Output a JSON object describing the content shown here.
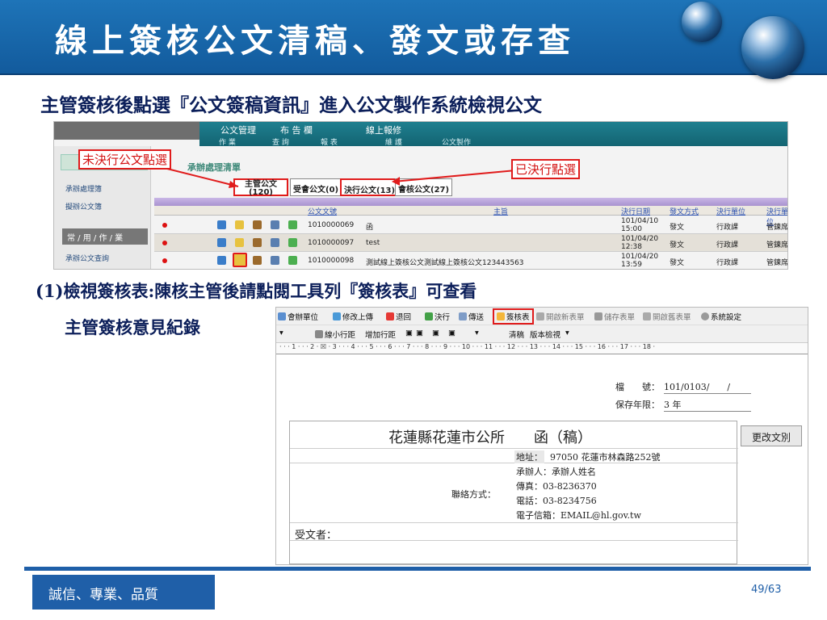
{
  "slide": {
    "title": "線上簽核公文清稿、發文或存查",
    "subtitle": "主管簽核後點選『公文簽稿資訊』進入公文製作系統檢視公文",
    "step_line": "(1)檢視簽核表:陳核主管後請點閱工具列『簽核表』可查看",
    "step_line2": "主管簽核意見紀錄",
    "footer": "誠信、專業、品質",
    "page": "49/63"
  },
  "screenshot1": {
    "nav_tabs": [
      "公文管理",
      "布 告 欄",
      "線上報修"
    ],
    "sub_nav": [
      "作 業",
      "查 詢",
      "報 表",
      "維 護",
      "公文製作"
    ],
    "left_items": [
      "承辦處理簿",
      "擬辦公文簿",
      "承辦公文查詢"
    ],
    "left_head": "常 / 用 / 作 / 業",
    "pending_title": "承辦處理清單",
    "callout_left": "未決行公文點選",
    "callout_right": "已決行點選",
    "tabs": [
      "主管公文 (120)",
      "受會公文(0)",
      "決行公文(13)",
      "會核公文(27)"
    ],
    "headers": [
      "公文文號",
      "主旨",
      "決行日期",
      "發文方式",
      "決行單位",
      "決行單位"
    ],
    "rows": [
      {
        "doc_no": "1010000069",
        "subject": "函",
        "date": "101/04/10 15:00",
        "method": "發文",
        "unit": "行政課",
        "person": "管鍊席"
      },
      {
        "doc_no": "1010000097",
        "subject": "test",
        "date": "101/04/20 12:38",
        "method": "發文",
        "unit": "行政課",
        "person": "管鍊席"
      },
      {
        "doc_no": "1010000098",
        "subject": "測試線上簽核公文測試線上簽核公文123443563",
        "date": "101/04/20 13:59",
        "method": "發文",
        "unit": "行政課",
        "person": "管鍊席"
      }
    ]
  },
  "screenshot2": {
    "toolbar": [
      "會辦單位",
      "修改上傳",
      "退回",
      "決行",
      "傳送",
      "簽核表",
      "開啟新表單",
      "儲存表單",
      "開啟舊表單",
      "系統設定"
    ],
    "toolbar2": [
      "線小行距",
      "增加行距",
      "清稿",
      "版本檢視"
    ],
    "ruler": "· · · 1 · · · 2 · ☒ · 3 · · · 4 · · · 5 · · · 6 · · · 7 · · · 8 · · · 9 · · · 10 · · · 11 · · · 12 · · · 13 · · · 14 · · · 15 · · · 16 · · · 17 · · · 18 ·",
    "file_no_label": "檔　　號：",
    "file_no": "101/0103/　　/",
    "retention_label": "保存年限：",
    "retention": "3 年",
    "doc_title": "花蓮縣花蓮市公所　　函（稿）",
    "change_button": "更改文別",
    "address_label": "地址：",
    "address": "97050 花蓮市林森路252號",
    "contact_label": "聯絡方式：",
    "contacts": [
      "承辦人：承辦人姓名",
      "傳真：03-8236370",
      "電話：03-8234756",
      "電子信箱：EMAIL@hl.gov.tw"
    ],
    "recipient_label": "受文者："
  },
  "colors": {
    "title_bar": "#1e74b8",
    "accent": "#1f5fa8",
    "highlight": "#e01b1b"
  }
}
